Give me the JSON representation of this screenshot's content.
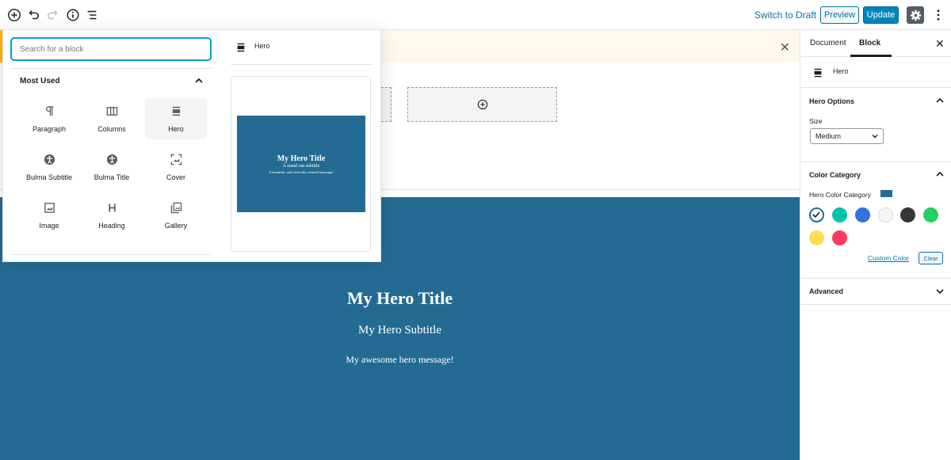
{
  "toolbar": {
    "switch_to_draft": "Switch to Draft",
    "preview": "Preview",
    "update": "Update"
  },
  "editor": {
    "hero_title": "My Hero Title",
    "hero_subtitle": "My Hero Subtitle",
    "hero_message": "My awesome hero message!",
    "hero_color": "#246b94"
  },
  "inserter": {
    "search_placeholder": "Search for a block",
    "section_title": "Most Used",
    "blocks": [
      {
        "label": "Paragraph",
        "icon": "paragraph-icon"
      },
      {
        "label": "Columns",
        "icon": "columns-icon"
      },
      {
        "label": "Hero",
        "icon": "hero-icon"
      },
      {
        "label": "Bulma Subtitle",
        "icon": "accessibility-icon"
      },
      {
        "label": "Bulma Title",
        "icon": "accessibility-icon"
      },
      {
        "label": "Cover",
        "icon": "cover-icon"
      },
      {
        "label": "Image",
        "icon": "image-icon"
      },
      {
        "label": "Heading",
        "icon": "heading-icon"
      },
      {
        "label": "Gallery",
        "icon": "gallery-icon"
      }
    ],
    "preview_label": "Hero",
    "preview_title": "My Hero Title",
    "preview_subtitle": "A stand out subtitle",
    "preview_message": "A beautiful, and vertically centered message!"
  },
  "sidebar": {
    "tab_document": "Document",
    "tab_block": "Block",
    "block_name": "Hero",
    "hero_options": {
      "title": "Hero Options",
      "size_label": "Size",
      "size_value": "Medium"
    },
    "color_category": {
      "title": "Color Category",
      "field_label": "Hero Color Category",
      "colors": [
        "#246b94",
        "#00c4a7",
        "#3273dc",
        "#f5f5f5",
        "#363636",
        "#23d160",
        "#ffdd57",
        "#ff3860"
      ],
      "custom_color": "Custom Color",
      "clear": "Clear"
    },
    "advanced": {
      "title": "Advanced"
    }
  }
}
